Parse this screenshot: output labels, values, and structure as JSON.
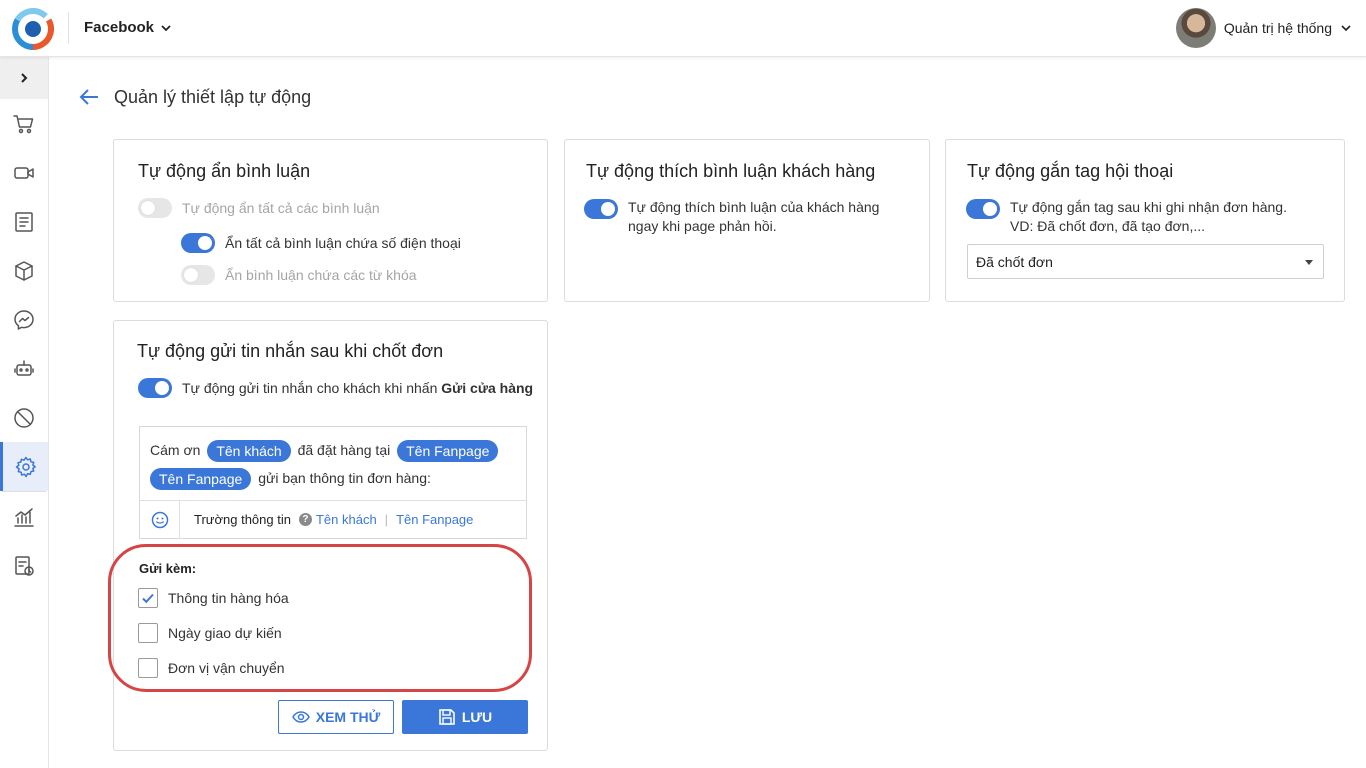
{
  "topbar": {
    "channel": "Facebook",
    "user_name": "Quản trị hệ thống"
  },
  "sidebar": {
    "items": [
      {
        "icon": "cart-icon"
      },
      {
        "icon": "video-icon"
      },
      {
        "icon": "document-icon"
      },
      {
        "icon": "box-icon"
      },
      {
        "icon": "messenger-icon"
      },
      {
        "icon": "robot-icon"
      },
      {
        "icon": "block-icon"
      },
      {
        "icon": "gear-icon",
        "active": true
      },
      {
        "icon": "chart-icon"
      },
      {
        "icon": "report-clock-icon"
      }
    ]
  },
  "page": {
    "title": "Quản lý thiết lập tự động"
  },
  "hide_comments": {
    "title": "Tự động ẩn bình luận",
    "hide_all": {
      "label": "Tự động ẩn tất cả các bình luận",
      "on": false
    },
    "hide_phone": {
      "label": "Ẩn tất cả bình luận chứa số điện thoại",
      "on": true
    },
    "hide_keywords": {
      "label": "Ẩn bình luận chứa các từ khóa",
      "on": false
    }
  },
  "like_comments": {
    "title": "Tự động thích bình luận khách hàng",
    "toggle": {
      "line1": "Tự động thích bình luận của khách hàng",
      "line2": "ngay khi page phản hồi.",
      "on": true
    }
  },
  "tag_conversation": {
    "title": "Tự động gắn tag hội thoại",
    "toggle": {
      "line1": "Tự động gắn tag sau khi ghi nhận đơn hàng.",
      "line2": "VD: Đã chốt đơn, đã tạo đơn,...",
      "on": true
    },
    "selected_tag": "Đã chốt đơn"
  },
  "send_message": {
    "title": "Tự động gửi tin nhắn sau khi chốt đơn",
    "toggle": {
      "text": "Tự động gửi tin nhắn cho khách khi nhấn ",
      "bold": "Gửi cửa hàng",
      "on": true
    },
    "message": {
      "part1": "Cám ơn",
      "chip_customer": "Tên khách",
      "part2": "đã đặt hàng tại",
      "chip_fanpage_1": "Tên Fanpage",
      "chip_fanpage_2": "Tên Fanpage",
      "part3": "gửi bạn thông tin đơn hàng:"
    },
    "fields_label": "Trường thông tin",
    "field_customer": "Tên khách",
    "field_fanpage": "Tên Fanpage",
    "attach_label": "Gửi kèm:",
    "attachments": [
      {
        "label": "Thông tin hàng hóa",
        "checked": true
      },
      {
        "label": "Ngày giao dự kiến",
        "checked": false
      },
      {
        "label": "Đơn vị vận chuyển",
        "checked": false
      }
    ],
    "preview_label": "XEM THỬ",
    "save_label": "LƯU"
  },
  "colors": {
    "accent": "#3a77d8",
    "highlight": "#d64545"
  }
}
